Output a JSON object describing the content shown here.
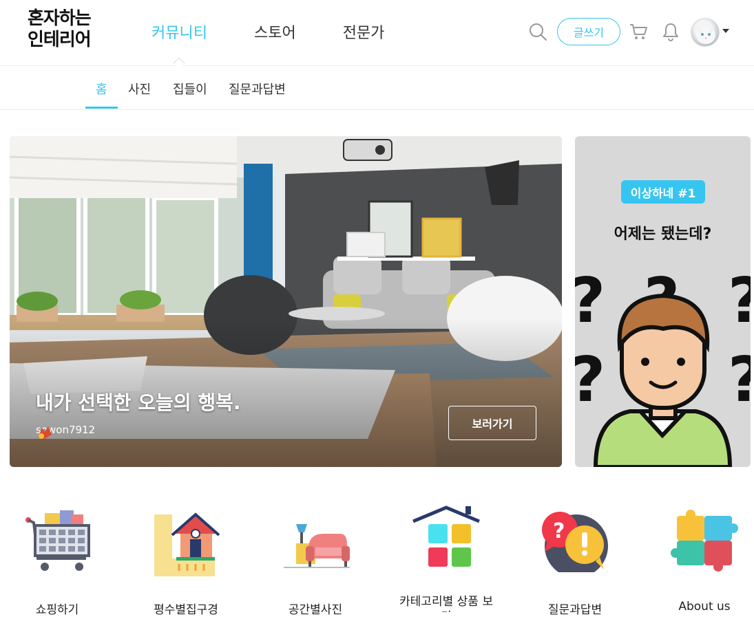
{
  "logo": {
    "line1": "혼자하는",
    "line2": "인테리어"
  },
  "main_nav": [
    {
      "label": "커뮤니티",
      "active": true
    },
    {
      "label": "스토어",
      "active": false
    },
    {
      "label": "전문가",
      "active": false
    }
  ],
  "header_tools": {
    "write_button": "글쓰기",
    "icons": [
      "search-icon",
      "cart-icon",
      "bell-icon",
      "avatar",
      "chevron-down-icon"
    ]
  },
  "sub_nav": [
    {
      "label": "홈",
      "active": true
    },
    {
      "label": "사진",
      "active": false
    },
    {
      "label": "집들이",
      "active": false
    },
    {
      "label": "질문과답변",
      "active": false
    }
  ],
  "hero": {
    "title": "내가 선택한 오늘의 행복.",
    "username": "sowon7912",
    "button": "보러가기"
  },
  "side_banner": {
    "badge": "이상하네 #1",
    "title": "어제는 됐는데?"
  },
  "categories": [
    {
      "label": "쇼핑하기",
      "icon": "shopping-cart-icon"
    },
    {
      "label": "평수별집구경",
      "icon": "house-ruler-icon"
    },
    {
      "label": "공간별사진",
      "icon": "living-room-icon"
    },
    {
      "label": "카테고리별 상품 보기",
      "icon": "category-house-icon"
    },
    {
      "label": "질문과답변",
      "icon": "question-bubble-icon"
    },
    {
      "label": "About us",
      "icon": "puzzle-icon"
    }
  ],
  "colors": {
    "accent": "#35c5f0",
    "text": "#222222",
    "border": "#ececec"
  }
}
